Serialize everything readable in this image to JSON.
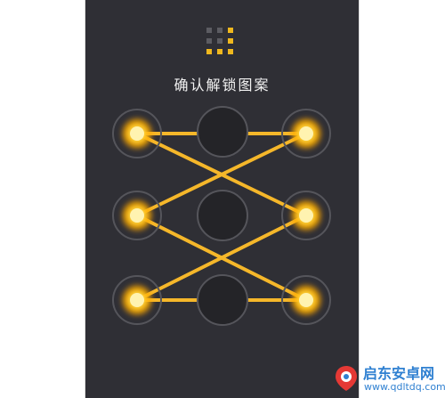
{
  "screen": {
    "prompt": "确认解锁图案"
  },
  "pattern_preview": {
    "cells": [
      false,
      false,
      true,
      false,
      false,
      true,
      true,
      true,
      true
    ]
  },
  "pattern": {
    "selected_nodes": [
      1,
      3,
      4,
      6,
      7,
      9
    ],
    "unselected_nodes": [
      2,
      5,
      8
    ],
    "path_order": [
      1,
      9,
      7,
      3
    ],
    "path_order_2": [
      1,
      3
    ],
    "active_color": "#ffb300",
    "line_color": "#f5b72a",
    "ring_color": "#55555b",
    "inactive_fill": "#242428"
  },
  "watermark": {
    "title": "启东安卓网",
    "url": "www.qdltdq.com",
    "brand_color": "#2f80d1",
    "accent_color": "#e53935"
  }
}
